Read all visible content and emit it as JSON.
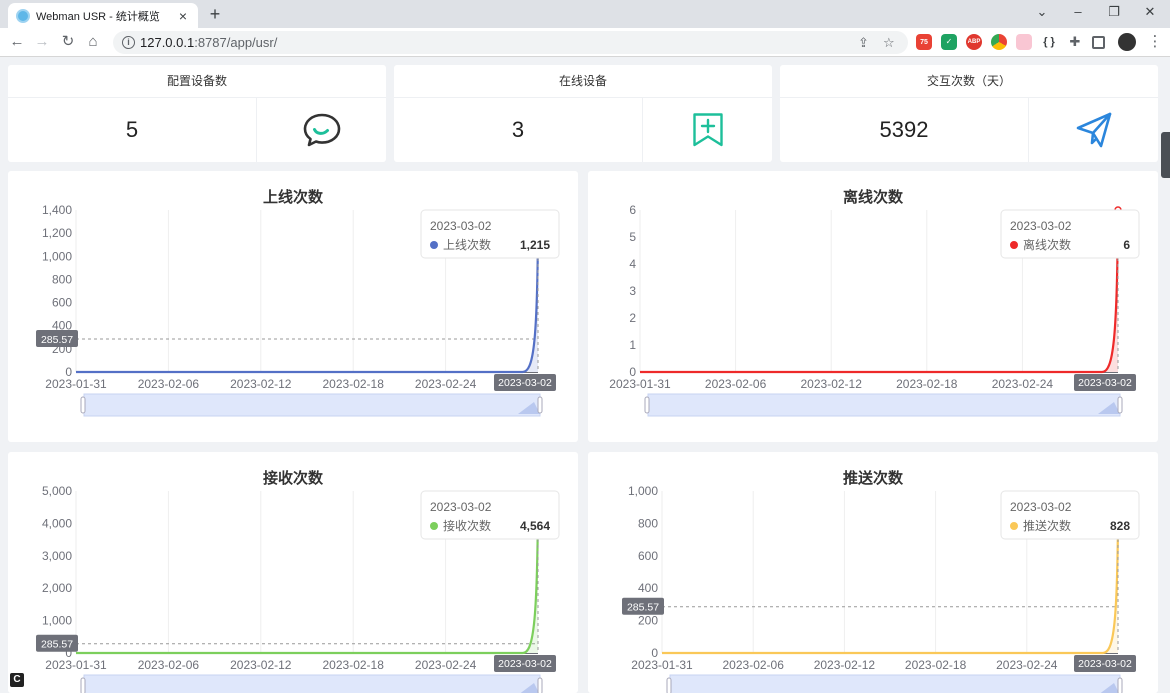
{
  "browser": {
    "tab_title": "Webman USR - 统计概览",
    "tab_close": "×",
    "new_tab": "+",
    "url_host": "127.0.0.1",
    "url_port_path": ":8787/app/usr/",
    "ext_badge": "75",
    "ext_abp": "ABP",
    "ext_json": "{ }"
  },
  "stats": [
    {
      "label": "配置设备数",
      "value": "5",
      "icon": "chat-bubble-icon",
      "color": "#333333"
    },
    {
      "label": "在线设备",
      "value": "3",
      "icon": "bookmark-add-icon",
      "color": "#1dbf9a"
    },
    {
      "label": "交互次数（天）",
      "value": "5392",
      "icon": "paper-plane-icon",
      "color": "#2b86dc"
    }
  ],
  "chart_data": [
    {
      "type": "line",
      "title": "上线次数",
      "color": "#5470c6",
      "x": [
        "2023-01-31",
        "2023-02-01",
        "2023-02-02",
        "2023-02-03",
        "2023-02-04",
        "2023-02-05",
        "2023-02-06",
        "2023-02-07",
        "2023-02-08",
        "2023-02-09",
        "2023-02-10",
        "2023-02-11",
        "2023-02-12",
        "2023-02-13",
        "2023-02-14",
        "2023-02-15",
        "2023-02-16",
        "2023-02-17",
        "2023-02-18",
        "2023-02-19",
        "2023-02-20",
        "2023-02-21",
        "2023-02-22",
        "2023-02-23",
        "2023-02-24",
        "2023-02-25",
        "2023-02-26",
        "2023-02-27",
        "2023-02-28",
        "2023-03-01",
        "2023-03-02"
      ],
      "values": [
        0,
        0,
        0,
        0,
        0,
        0,
        0,
        0,
        0,
        0,
        0,
        0,
        0,
        0,
        0,
        0,
        0,
        0,
        0,
        0,
        0,
        0,
        0,
        0,
        0,
        0,
        0,
        0,
        0,
        0,
        1215
      ],
      "x_ticks": [
        "2023-01-31",
        "2023-02-06",
        "2023-02-12",
        "2023-02-18",
        "2023-02-24"
      ],
      "y_ticks": [
        "0",
        "200",
        "400",
        "600",
        "800",
        "1,000",
        "1,200",
        "1,400"
      ],
      "ylim": [
        0,
        1400
      ],
      "pointer_label": "285.57",
      "pointer_value": 285.57,
      "tooltip": {
        "date": "2023-03-02",
        "series": "上线次数",
        "value": "1,215"
      },
      "axis_date_label": "2023-03-02"
    },
    {
      "type": "line",
      "title": "离线次数",
      "color": "#ee2a2a",
      "x": [
        "2023-01-31",
        "2023-02-01",
        "2023-02-02",
        "2023-02-03",
        "2023-02-04",
        "2023-02-05",
        "2023-02-06",
        "2023-02-07",
        "2023-02-08",
        "2023-02-09",
        "2023-02-10",
        "2023-02-11",
        "2023-02-12",
        "2023-02-13",
        "2023-02-14",
        "2023-02-15",
        "2023-02-16",
        "2023-02-17",
        "2023-02-18",
        "2023-02-19",
        "2023-02-20",
        "2023-02-21",
        "2023-02-22",
        "2023-02-23",
        "2023-02-24",
        "2023-02-25",
        "2023-02-26",
        "2023-02-27",
        "2023-02-28",
        "2023-03-01",
        "2023-03-02"
      ],
      "values": [
        0,
        0,
        0,
        0,
        0,
        0,
        0,
        0,
        0,
        0,
        0,
        0,
        0,
        0,
        0,
        0,
        0,
        0,
        0,
        0,
        0,
        0,
        0,
        0,
        0,
        0,
        0,
        0,
        0,
        0,
        6
      ],
      "x_ticks": [
        "2023-01-31",
        "2023-02-06",
        "2023-02-12",
        "2023-02-18",
        "2023-02-24"
      ],
      "y_ticks": [
        "0",
        "1",
        "2",
        "3",
        "4",
        "5",
        "6"
      ],
      "ylim": [
        0,
        6
      ],
      "pointer_label": "",
      "pointer_value": null,
      "tooltip": {
        "date": "2023-03-02",
        "series": "离线次数",
        "value": "6"
      },
      "axis_date_label": "2023-03-02"
    },
    {
      "type": "line",
      "title": "接收次数",
      "color": "#7ccf5c",
      "x": [
        "2023-01-31",
        "2023-02-01",
        "2023-02-02",
        "2023-02-03",
        "2023-02-04",
        "2023-02-05",
        "2023-02-06",
        "2023-02-07",
        "2023-02-08",
        "2023-02-09",
        "2023-02-10",
        "2023-02-11",
        "2023-02-12",
        "2023-02-13",
        "2023-02-14",
        "2023-02-15",
        "2023-02-16",
        "2023-02-17",
        "2023-02-18",
        "2023-02-19",
        "2023-02-20",
        "2023-02-21",
        "2023-02-22",
        "2023-02-23",
        "2023-02-24",
        "2023-02-25",
        "2023-02-26",
        "2023-02-27",
        "2023-02-28",
        "2023-03-01",
        "2023-03-02"
      ],
      "values": [
        0,
        0,
        0,
        0,
        0,
        0,
        0,
        0,
        0,
        0,
        0,
        0,
        0,
        0,
        0,
        0,
        0,
        0,
        0,
        0,
        0,
        0,
        0,
        0,
        0,
        0,
        0,
        0,
        0,
        0,
        4564
      ],
      "x_ticks": [
        "2023-01-31",
        "2023-02-06",
        "2023-02-12",
        "2023-02-18",
        "2023-02-24"
      ],
      "y_ticks": [
        "0",
        "1,000",
        "2,000",
        "3,000",
        "4,000",
        "5,000"
      ],
      "ylim": [
        0,
        5000
      ],
      "pointer_label": "285.57",
      "pointer_value": 285.57,
      "tooltip": {
        "date": "2023-03-02",
        "series": "接收次数",
        "value": "4,564"
      },
      "axis_date_label": "2023-03-02"
    },
    {
      "type": "line",
      "title": "推送次数",
      "color": "#fac858",
      "x": [
        "2023-01-31",
        "2023-02-01",
        "2023-02-02",
        "2023-02-03",
        "2023-02-04",
        "2023-02-05",
        "2023-02-06",
        "2023-02-07",
        "2023-02-08",
        "2023-02-09",
        "2023-02-10",
        "2023-02-11",
        "2023-02-12",
        "2023-02-13",
        "2023-02-14",
        "2023-02-15",
        "2023-02-16",
        "2023-02-17",
        "2023-02-18",
        "2023-02-19",
        "2023-02-20",
        "2023-02-21",
        "2023-02-22",
        "2023-02-23",
        "2023-02-24",
        "2023-02-25",
        "2023-02-26",
        "2023-02-27",
        "2023-02-28",
        "2023-03-01",
        "2023-03-02"
      ],
      "values": [
        0,
        0,
        0,
        0,
        0,
        0,
        0,
        0,
        0,
        0,
        0,
        0,
        0,
        0,
        0,
        0,
        0,
        0,
        0,
        0,
        0,
        0,
        0,
        0,
        0,
        0,
        0,
        0,
        0,
        0,
        828
      ],
      "x_ticks": [
        "2023-01-31",
        "2023-02-06",
        "2023-02-12",
        "2023-02-18",
        "2023-02-24"
      ],
      "y_ticks": [
        "0",
        "200",
        "400",
        "600",
        "800",
        "1,000"
      ],
      "ylim": [
        0,
        1000
      ],
      "pointer_label": "285.57",
      "pointer_value": 285.57,
      "tooltip": {
        "date": "2023-03-02",
        "series": "推送次数",
        "value": "828"
      },
      "axis_date_label": "2023-03-02"
    }
  ]
}
